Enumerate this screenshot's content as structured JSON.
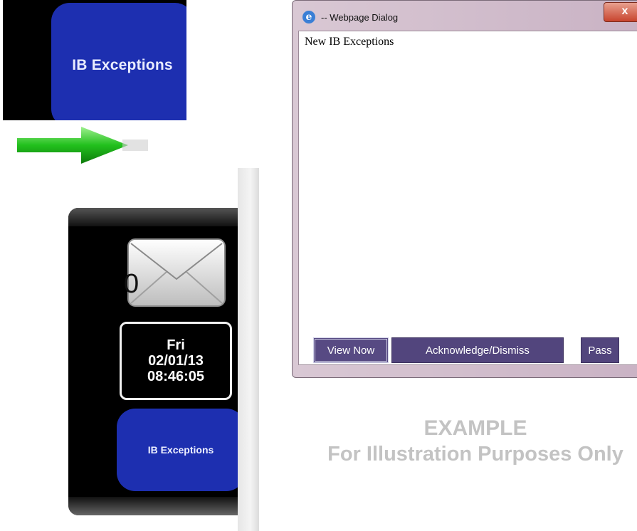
{
  "zoom_crop": {
    "button_label": "IB Exceptions"
  },
  "side_panel": {
    "mail_count": "0",
    "clock": {
      "day": "Fri",
      "date": "02/01/13",
      "time": "08:46:05"
    },
    "ib_button_label": "IB Exceptions"
  },
  "dialog": {
    "icon": "ie-icon",
    "title": "-- Webpage Dialog",
    "close_label": "x",
    "heading": "New IB Exceptions",
    "buttons": {
      "view_now": "View Now",
      "acknowledge": "Acknowledge/Dismiss",
      "pass": "Pass"
    }
  },
  "watermark": {
    "line1": "EXAMPLE",
    "line2": "For Illustration Purposes Only"
  },
  "colors": {
    "ib_blue": "#1d2fb0",
    "dialog_button": "#52457d",
    "arrow_green": "#2fbf2c",
    "watermark_gray": "#c3c3c3"
  }
}
